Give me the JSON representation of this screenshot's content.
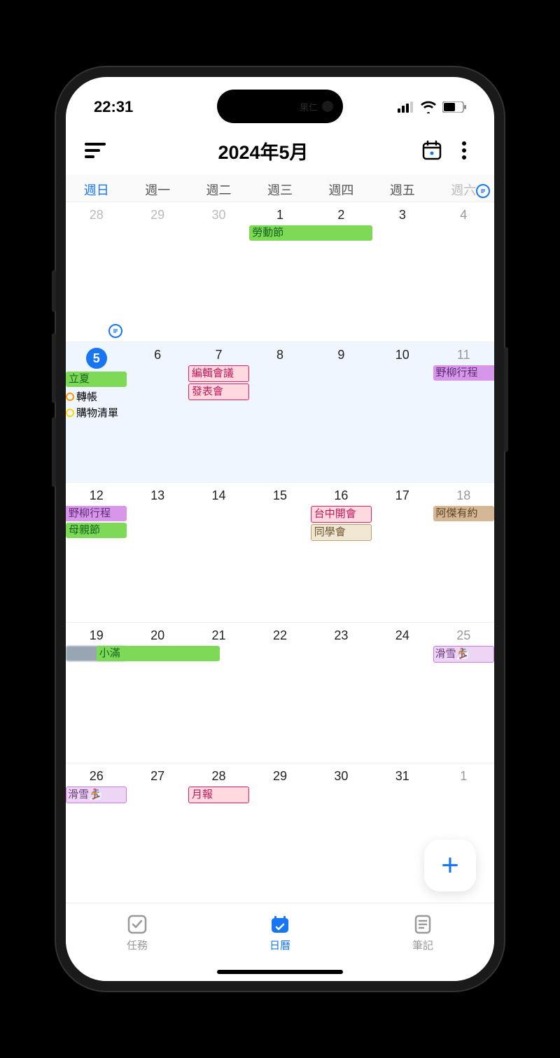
{
  "status": {
    "time": "22:31",
    "island_text": "果仁"
  },
  "header": {
    "title": "2024年5月"
  },
  "weekdays": [
    "週日",
    "週一",
    "週二",
    "週三",
    "週四",
    "週五",
    "週六"
  ],
  "weeks": [
    {
      "current": false,
      "days": [
        {
          "num": "28",
          "otherMonth": true
        },
        {
          "num": "29",
          "otherMonth": true
        },
        {
          "num": "30",
          "otherMonth": true
        },
        {
          "num": "1",
          "events": [
            {
              "label": "勞動節",
              "class": "ev-green-span",
              "span": 2
            }
          ]
        },
        {
          "num": "2"
        },
        {
          "num": "3"
        },
        {
          "num": "4",
          "sat": true,
          "noteBadge": true
        }
      ]
    },
    {
      "current": true,
      "days": [
        {
          "num": "5",
          "today": true,
          "events": [
            {
              "label": "立夏",
              "class": "ev-green"
            }
          ],
          "tasks": [
            {
              "label": "轉帳",
              "dot": "dot-orange"
            },
            {
              "label": "購物清單",
              "dot": "dot-yellow"
            }
          ],
          "noteBadge": true
        },
        {
          "num": "6"
        },
        {
          "num": "7",
          "events": [
            {
              "label": "編輯會議",
              "class": "ev-pink-border"
            },
            {
              "label": "發表會",
              "class": "ev-pink-border"
            }
          ]
        },
        {
          "num": "8"
        },
        {
          "num": "9"
        },
        {
          "num": "10"
        },
        {
          "num": "11",
          "sat": true,
          "events": [
            {
              "label": "野柳行程",
              "class": "ev-purple-left"
            }
          ]
        }
      ]
    },
    {
      "current": false,
      "days": [
        {
          "num": "12",
          "events": [
            {
              "label": "野柳行程",
              "class": "ev-purple-right"
            },
            {
              "label": "母親節",
              "class": "ev-green"
            }
          ]
        },
        {
          "num": "13"
        },
        {
          "num": "14"
        },
        {
          "num": "15"
        },
        {
          "num": "16",
          "events": [
            {
              "label": "台中開會",
              "class": "ev-pink-border"
            },
            {
              "label": "同學會",
              "class": "ev-beige"
            }
          ]
        },
        {
          "num": "17"
        },
        {
          "num": "18",
          "sat": true,
          "events": [
            {
              "label": "阿傑有約",
              "class": "ev-brown"
            }
          ]
        }
      ]
    },
    {
      "current": false,
      "days": [
        {
          "num": "19",
          "events": [
            {
              "label": "xxx",
              "class": "ev-gray-blur"
            }
          ]
        },
        {
          "num": "20",
          "events": [
            {
              "label": "小滿",
              "class": "ev-green-span",
              "span": 2,
              "offset": -0.5
            }
          ]
        },
        {
          "num": "21"
        },
        {
          "num": "22"
        },
        {
          "num": "23"
        },
        {
          "num": "24"
        },
        {
          "num": "25",
          "sat": true,
          "events": [
            {
              "label": "滑雪🏂",
              "class": "ev-lav"
            }
          ]
        }
      ]
    },
    {
      "current": false,
      "days": [
        {
          "num": "26",
          "events": [
            {
              "label": "滑雪🏂",
              "class": "ev-lav"
            }
          ]
        },
        {
          "num": "27"
        },
        {
          "num": "28",
          "events": [
            {
              "label": "月報",
              "class": "ev-pink-border"
            }
          ]
        },
        {
          "num": "29"
        },
        {
          "num": "30"
        },
        {
          "num": "31"
        },
        {
          "num": "1",
          "otherMonth": true,
          "sat": true
        }
      ]
    }
  ],
  "nav": {
    "tasks": "任務",
    "calendar": "日曆",
    "notes": "筆記"
  }
}
